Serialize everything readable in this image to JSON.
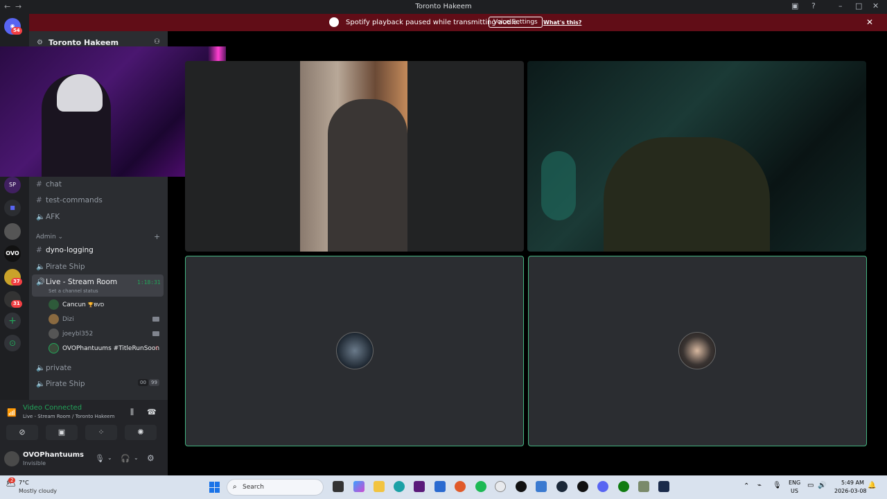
{
  "window": {
    "title": "Toronto Hakeem"
  },
  "rail": {
    "badges": [
      "54",
      "37",
      "31"
    ]
  },
  "banner": {
    "message": "Spotify playback paused while transmitting audio.",
    "voice_settings": "Voice Settings",
    "whats_this": "What's this?"
  },
  "server": {
    "name": "Toronto Hakeem"
  },
  "channels": {
    "chat": "chat",
    "test_commands": "test-commands",
    "afk": "AFK",
    "admin_category": "Admin",
    "dyno_logging": "dyno-logging",
    "pirate_ship_1": "Pirate Ship",
    "live_stream": "Live - Stream Room",
    "live_timer": "1:18:31",
    "channel_status": "Set a channel status",
    "private": "private",
    "pirate_ship_2": "Pirate Ship",
    "pirate_count_a": "00",
    "pirate_count_b": "99"
  },
  "voice_users": [
    {
      "name": "Cancun",
      "tag": "🏆BVD"
    },
    {
      "name": "Dizi"
    },
    {
      "name": "joeybl352"
    },
    {
      "name": "OVOPhantuums #TitleRunSoon"
    }
  ],
  "voice_panel": {
    "status": "Video Connected",
    "location": "Live - Stream Room / Toronto Hakeem"
  },
  "user": {
    "name": "OVOPhantuums",
    "status": "Invisible"
  },
  "taskbar": {
    "weather_temp": "7°C",
    "weather_desc": "Mostly cloudy",
    "weather_badge": "2",
    "search": "Search",
    "lang": "ENG",
    "region": "US",
    "time": "5:49 AM",
    "date": "2026-03-08"
  },
  "colors": {
    "banner": "#610d17",
    "speaking": "#43b581",
    "connected": "#23a55a"
  }
}
